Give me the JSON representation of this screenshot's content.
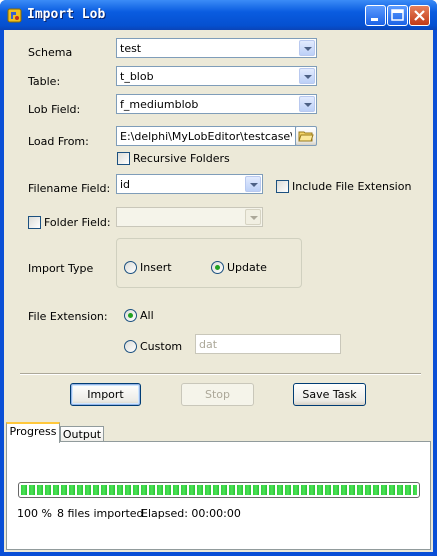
{
  "window": {
    "title": "Import Lob"
  },
  "form": {
    "schema_label": "Schema",
    "schema_value": "test",
    "table_label": "Table:",
    "table_value": "t_blob",
    "lob_field_label": "Lob Field:",
    "lob_field_value": "f_mediumblob",
    "load_from_label": "Load From:",
    "load_from_value": "E:\\delphi\\MyLobEditor\\testcase\\f",
    "recursive_label": "Recursive Folders",
    "recursive_checked": false,
    "filename_field_label": "Filename Field:",
    "filename_field_value": "id",
    "include_ext_label": "Include File Extension",
    "include_ext_checked": false,
    "folder_field_label": "Folder Field:",
    "folder_field_checked": false,
    "folder_field_value": "",
    "import_type_label": "Import Type",
    "import_type_options": [
      "Insert",
      "Update"
    ],
    "import_type_selected": "Update",
    "file_extension_label": "File Extension:",
    "file_extension_options": [
      "All",
      "Custom"
    ],
    "file_extension_selected": "All",
    "custom_ext_value": "dat"
  },
  "buttons": {
    "import": "Import",
    "stop": "Stop",
    "save_task": "Save Task"
  },
  "tabs": [
    "Progress",
    "Output"
  ],
  "progress": {
    "percent_value": 1.0,
    "percent_text": "100 %",
    "files_text": "8 files imported",
    "elapsed_text": "Elapsed: 00:00:00"
  },
  "colors": {
    "title_bar": "#0a5ce0",
    "progress_fill": "#2fd23a",
    "window_bg": "#ece9d8"
  }
}
